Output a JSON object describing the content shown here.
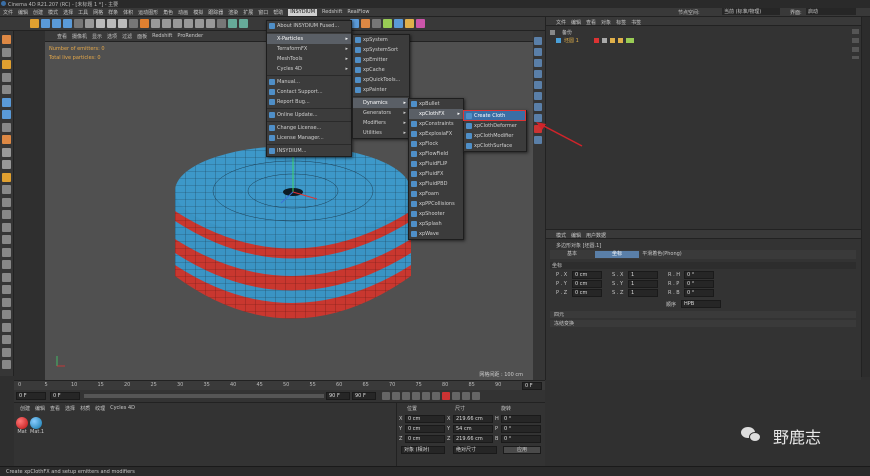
{
  "app": {
    "title": "Cinema 4D R21.207 (RC) - [未标题 1 *] - 主要"
  },
  "main_menu": [
    "文件",
    "编辑",
    "创建",
    "模式",
    "选择",
    "工具",
    "网格",
    "样条",
    "体积",
    "运动图形",
    "角色",
    "动画",
    "模拟",
    "跟踪器",
    "渲染",
    "扩展",
    "窗口",
    "帮助",
    "INSYDIUM",
    "Redshift",
    "RealFlow"
  ],
  "top_right": {
    "node_space_label": "节点空间:",
    "node_space_value": "当前 (标准/物理)",
    "layout_label": "界面:",
    "layout_value": "启动"
  },
  "viewport": {
    "menu": [
      "查看",
      "摄像机",
      "显示",
      "选项",
      "过滤",
      "面板",
      "Redshift",
      "ProRender"
    ],
    "hud_emitters": "Number of emitters: 0",
    "hud_particles": "Total live particles: 0",
    "grid_spacing": "网格间距 : 100 cm"
  },
  "insydium_menu": {
    "items": [
      {
        "label": "About INSYDIUM Fused...",
        "sep_after": true
      },
      {
        "label": "X-Particles",
        "submenu": true,
        "selected": true
      },
      {
        "label": "TerraformFX",
        "submenu": true
      },
      {
        "label": "MeshTools",
        "submenu": true
      },
      {
        "label": "Cycles 4D",
        "submenu": true,
        "sep_after": true
      },
      {
        "label": "Manual..."
      },
      {
        "label": "Contact Support..."
      },
      {
        "label": "Report Bug...",
        "sep_after": true
      },
      {
        "label": "Online Update...",
        "sep_after": true
      },
      {
        "label": "Change License..."
      },
      {
        "label": "License Manager...",
        "sep_after": true
      },
      {
        "label": "INSYDIUM..."
      }
    ]
  },
  "xparticles_menu": {
    "items": [
      {
        "label": "xpSystem"
      },
      {
        "label": "xpSystemSort"
      },
      {
        "label": "xpEmitter"
      },
      {
        "label": "xpCache"
      },
      {
        "label": "xpQuickTools..."
      },
      {
        "label": "xpPainter",
        "sep_after": true
      },
      {
        "label": "Dynamics",
        "submenu": true,
        "selected": true
      },
      {
        "label": "Generators",
        "submenu": true
      },
      {
        "label": "Modifiers",
        "submenu": true
      },
      {
        "label": "Utilities",
        "submenu": true
      }
    ]
  },
  "dynamics_menu": {
    "items": [
      {
        "label": "xpBullet"
      },
      {
        "label": "xpClothFX",
        "submenu": true,
        "selected": true
      },
      {
        "label": "xpConstraints"
      },
      {
        "label": "xpExplosiaFX"
      },
      {
        "label": "xpFlock"
      },
      {
        "label": "xpFlowField"
      },
      {
        "label": "xpFluidFLIP"
      },
      {
        "label": "xpFluidFX"
      },
      {
        "label": "xpFluidPBD"
      },
      {
        "label": "xpFoam"
      },
      {
        "label": "xpPPCollisions"
      },
      {
        "label": "xpShooter"
      },
      {
        "label": "xpSplash"
      },
      {
        "label": "xpWave"
      }
    ]
  },
  "clothfx_menu": {
    "items": [
      {
        "label": "Create Cloth",
        "highlighted": true
      },
      {
        "label": "xpClothDeformer"
      },
      {
        "label": "xpClothModifier"
      },
      {
        "label": "xpClothSurface"
      }
    ]
  },
  "object_manager": {
    "menu": [
      "文件",
      "编辑",
      "查看",
      "对象",
      "标签",
      "书签"
    ],
    "objects": [
      {
        "name": "备份"
      },
      {
        "name": "坯圆 1"
      }
    ]
  },
  "attributes": {
    "menu": [
      "模式",
      "编辑",
      "用户数据"
    ],
    "title": "多边形对象 [坯圆.1]",
    "tabs": [
      "基本",
      "坐标",
      "平滑着色(Phong)"
    ],
    "active_tab": "坐标",
    "section": "坐标",
    "rows": [
      {
        "p_label": "P . X",
        "p_val": "0 cm",
        "s_label": "S . X",
        "s_val": "1",
        "r_label": "R . H",
        "r_val": "0 °"
      },
      {
        "p_label": "P . Y",
        "p_val": "0 cm",
        "s_label": "S . Y",
        "s_val": "1",
        "r_label": "R . P",
        "r_val": "0 °"
      },
      {
        "p_label": "P . Z",
        "p_val": "0 cm",
        "s_label": "S . Z",
        "s_val": "1",
        "r_label": "R . B",
        "r_val": "0 °"
      }
    ],
    "order_label": "顺序",
    "order_value": "HPB",
    "collapsed": [
      "四元",
      "冻结变换"
    ]
  },
  "timeline": {
    "ticks": [
      "0",
      "5",
      "10",
      "15",
      "20",
      "25",
      "30",
      "35",
      "40",
      "45",
      "50",
      "55",
      "60",
      "65",
      "70",
      "75",
      "80",
      "85",
      "90"
    ],
    "current": "0 F",
    "start": "0 F",
    "end_a": "0 F",
    "end_b": "90 F",
    "end_c": "90 F"
  },
  "material": {
    "menu": [
      "创建",
      "编辑",
      "查看",
      "选择",
      "材质",
      "纹理",
      "Cycles 4D"
    ],
    "items": [
      "Mat",
      "Mat.1"
    ]
  },
  "coords": {
    "headers": [
      "位置",
      "尺寸",
      "旋转"
    ],
    "rows": [
      {
        "axis": "X",
        "pos": "0 cm",
        "size_axis": "X",
        "size": "219.66 cm",
        "rot_axis": "H",
        "rot": "0 °"
      },
      {
        "axis": "Y",
        "pos": "0 cm",
        "size_axis": "Y",
        "size": "54 cm",
        "rot_axis": "P",
        "rot": "0 °"
      },
      {
        "axis": "Z",
        "pos": "0 cm",
        "size_axis": "Z",
        "size": "219.66 cm",
        "rot_axis": "B",
        "rot": "0 °"
      }
    ],
    "mode_value": "对象 (相对)",
    "size_mode": "绝对尺寸",
    "apply": "应用"
  },
  "status_bar": "Create xpClothFX and setup emitters and modifiers",
  "watermark": "野鹿志",
  "colors": {
    "disc_blue": "#3c97c8",
    "disc_red": "#d23a32",
    "highlight_box": "#d33",
    "arrow": "#d0242a"
  }
}
